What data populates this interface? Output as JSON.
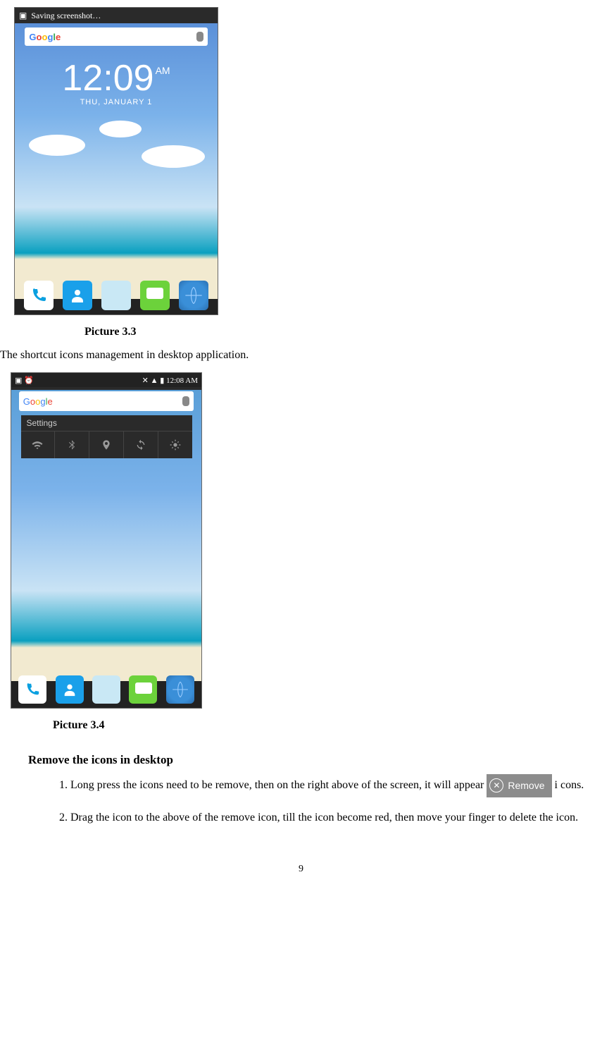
{
  "screenshot33": {
    "statusbar_text": "Saving screenshot…",
    "search_logo_letters": [
      "G",
      "o",
      "o",
      "g",
      "l",
      "e"
    ],
    "clock_time": "12:09",
    "clock_ampm": "AM",
    "clock_date": "THU, JANUARY 1",
    "dock": [
      "phone",
      "contacts",
      "apps",
      "messaging",
      "browser"
    ]
  },
  "caption33": "Picture 3.3",
  "paragraph1": "The shortcut icons management in desktop application.",
  "screenshot34": {
    "status_time": "12:08 AM",
    "search_text": "Google",
    "quicksettings_title": "Settings",
    "tiles": [
      "wifi",
      "bluetooth",
      "gps",
      "sync",
      "brightness"
    ],
    "dock": [
      "phone",
      "contacts",
      "apps",
      "messaging",
      "browser"
    ]
  },
  "caption34": "Picture 3.4",
  "subheading": "Remove the icons in desktop",
  "step1_a": "Long press the icons need to be remove, then on the right above of the screen, it will appear ",
  "remove_chip_label": "Remove",
  "step1_b": " i cons.",
  "step2": "Drag the icon to the above of the remove icon, till the icon become red, then move your finger to delete the icon.",
  "page_number": "9"
}
